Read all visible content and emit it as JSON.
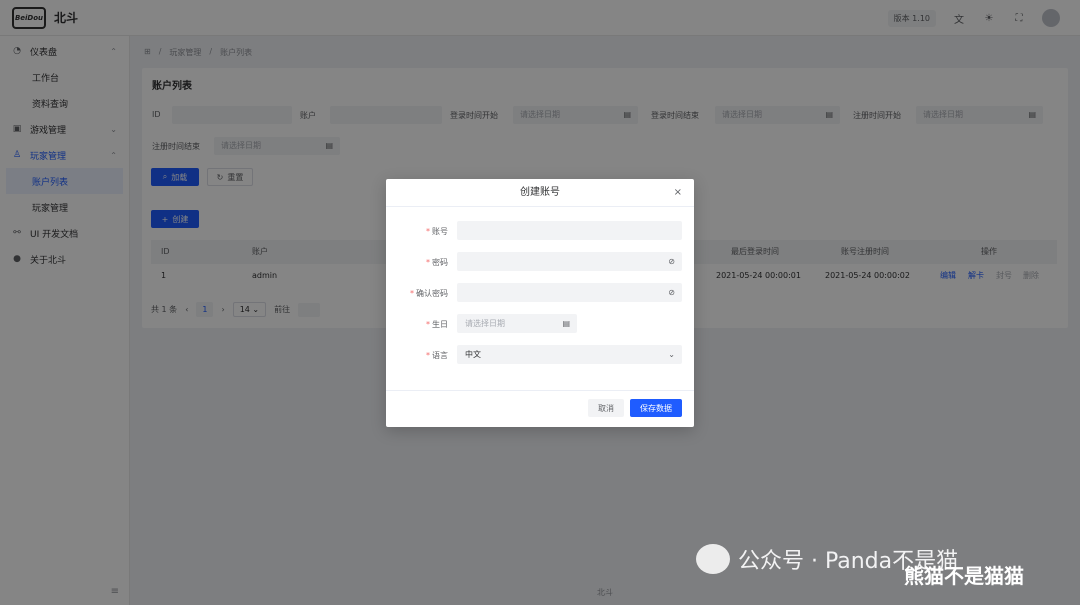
{
  "header": {
    "logo_text": "BeiDou",
    "brand": "北斗",
    "version": "版本 1.10",
    "icons": [
      "translate-icon",
      "theme-icon",
      "fullscreen-icon"
    ]
  },
  "sidebar": {
    "items": [
      {
        "label": "仪表盘",
        "icon": "dashboard-icon",
        "arrow": "⌃"
      },
      {
        "label": "工作台"
      },
      {
        "label": "资料查询"
      },
      {
        "label": "游戏管理",
        "icon": "game-icon",
        "arrow": "⌄"
      },
      {
        "label": "玩家管理",
        "icon": "user-icon",
        "arrow": "⌃"
      },
      {
        "label": "账户列表"
      },
      {
        "label": "玩家管理"
      },
      {
        "label": "UI 开发文档",
        "icon": "link-icon"
      },
      {
        "label": "关于北斗",
        "icon": "github-icon"
      }
    ],
    "collapse": "≡"
  },
  "breadcrumb": [
    "⊞",
    "/",
    "玩家管理",
    "/",
    "账户列表"
  ],
  "page": {
    "title": "账户列表",
    "filters": {
      "id_label": "ID",
      "account_label": "账户",
      "login_start_label": "登录时间开始",
      "login_end_label": "登录时间结束",
      "register_start_label": "注册时间开始",
      "register_end_label": "注册时间结束",
      "date_placeholder": "请选择日期"
    },
    "search_button": "加载",
    "reset_button": "重置",
    "create_button": "创建",
    "table": {
      "headers": [
        "ID",
        "账户",
        "最后登录时间",
        "账号注册时间",
        "操作"
      ],
      "rows": [
        {
          "id": "1",
          "account": "admin",
          "last_login": "2021-05-24 00:00:01",
          "registered": "2021-05-24 00:00:02",
          "actions": [
            "编辑",
            "解卡",
            "封号",
            "删除"
          ]
        }
      ]
    },
    "pager": {
      "total": "共 1 条",
      "prev": "‹",
      "page": "1",
      "next": "›",
      "size": "14",
      "goto": "前往"
    }
  },
  "footer": "北斗",
  "modal": {
    "title": "创建账号",
    "close": "×",
    "fields": {
      "account": "账号",
      "password": "密码",
      "confirm_password": "确认密码",
      "birthday": "生日",
      "birthday_placeholder": "请选择日期",
      "language": "语言",
      "language_value": "中文"
    },
    "cancel": "取消",
    "save": "保存数据"
  },
  "watermark": {
    "main": "公众号 · Panda不是猫",
    "sub": "熊猫不是猫猫"
  }
}
